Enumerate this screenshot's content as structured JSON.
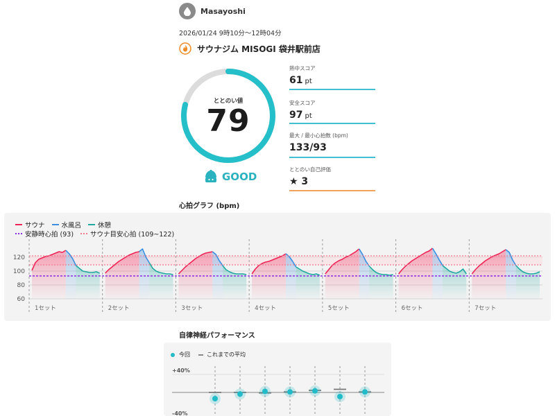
{
  "user": {
    "name": "Masayoshi",
    "avatar_icon": "water-drop-icon"
  },
  "session": {
    "datetime": "2026/01/24 9時10分〜12時04分"
  },
  "facility": {
    "name": "サウナジム MISOGI 袋井駅前店",
    "icon": "flame-icon"
  },
  "totonoi": {
    "label": "ととのい値",
    "value": "79",
    "max": 100,
    "progress": 0.79,
    "rating": "GOOD",
    "rating_icon": "sauna-mascot-icon"
  },
  "stats": [
    {
      "label": "熱中スコア",
      "value": "61",
      "unit": "pt"
    },
    {
      "label": "安全スコア",
      "value": "97",
      "unit": "pt"
    },
    {
      "label": "最大 / 最小心拍数 (bpm)",
      "value": "133/93",
      "unit": ""
    },
    {
      "label": "ととのい自己評価",
      "value": "★ 3",
      "unit": ""
    }
  ],
  "heart_rate": {
    "title": "心拍グラフ (bpm)",
    "legend": {
      "sauna": "サウナ",
      "cold_bath": "水風呂",
      "rest": "休憩",
      "resting_hr": "安静時心拍 (93)",
      "sauna_target": "サウナ目安心拍 (109~122)"
    },
    "colors": {
      "sauna": "#ee2255",
      "cold_bath": "#3a8fe0",
      "rest": "#1fa8a0",
      "resting_hr": "#8a2be2",
      "target": "#ef7a8f"
    }
  },
  "chart_data": [
    {
      "type": "line",
      "title": "心拍グラフ (bpm)",
      "ylim": [
        60,
        140
      ],
      "yticks": [
        60,
        80,
        100,
        120
      ],
      "resting_hr": 93,
      "target_range": [
        109,
        122
      ],
      "sets": [
        {
          "label": "1セット",
          "sauna": [
            [
              0,
              101
            ],
            [
              1,
              112
            ],
            [
              2,
              117
            ],
            [
              3,
              119
            ],
            [
              4,
              121
            ],
            [
              5,
              122
            ],
            [
              6,
              124
            ],
            [
              7,
              126
            ],
            [
              8,
              128
            ],
            [
              9,
              127
            ],
            [
              10,
              130
            ]
          ],
          "cold_bath": [
            [
              10,
              130
            ],
            [
              11,
              125
            ],
            [
              12,
              118
            ],
            [
              13,
              108
            ]
          ],
          "rest": [
            [
              13,
              108
            ],
            [
              14,
              104
            ],
            [
              15,
              100
            ],
            [
              16,
              99
            ],
            [
              17,
              98
            ],
            [
              18,
              98
            ],
            [
              19,
              99
            ],
            [
              20,
              97
            ]
          ]
        },
        {
          "label": "2セット",
          "sauna": [
            [
              0,
              97
            ],
            [
              1,
              102
            ],
            [
              2,
              106
            ],
            [
              3,
              110
            ],
            [
              4,
              114
            ],
            [
              5,
              117
            ],
            [
              6,
              120
            ],
            [
              7,
              123
            ],
            [
              8,
              125
            ],
            [
              9,
              127
            ],
            [
              10,
              128
            ]
          ],
          "cold_bath": [
            [
              10,
              128
            ],
            [
              11,
              132
            ],
            [
              12,
              120
            ],
            [
              13,
              112
            ]
          ],
          "rest": [
            [
              13,
              112
            ],
            [
              14,
              104
            ],
            [
              15,
              100
            ],
            [
              16,
              98
            ],
            [
              17,
              97
            ],
            [
              18,
              96
            ],
            [
              19,
              96
            ],
            [
              20,
              95
            ]
          ]
        },
        {
          "label": "3セット",
          "sauna": [
            [
              0,
              96
            ],
            [
              1,
              101
            ],
            [
              2,
              106
            ],
            [
              3,
              110
            ],
            [
              4,
              114
            ],
            [
              5,
              118
            ],
            [
              6,
              121
            ],
            [
              7,
              124
            ],
            [
              8,
              126
            ],
            [
              9,
              127
            ],
            [
              10,
              128
            ]
          ],
          "cold_bath": [
            [
              10,
              128
            ],
            [
              11,
              124
            ],
            [
              12,
              115
            ],
            [
              13,
              108
            ]
          ],
          "rest": [
            [
              13,
              108
            ],
            [
              14,
              102
            ],
            [
              15,
              99
            ],
            [
              16,
              97
            ],
            [
              17,
              96
            ],
            [
              18,
              96
            ],
            [
              19,
              96
            ],
            [
              20,
              95
            ]
          ]
        },
        {
          "label": "4セット",
          "sauna": [
            [
              0,
              96
            ],
            [
              1,
              103
            ],
            [
              2,
              108
            ],
            [
              3,
              111
            ],
            [
              4,
              113
            ],
            [
              5,
              114
            ],
            [
              6,
              116
            ],
            [
              7,
              118
            ],
            [
              8,
              120
            ],
            [
              9,
              122
            ],
            [
              10,
              125
            ]
          ],
          "cold_bath": [
            [
              10,
              125
            ],
            [
              11,
              121
            ],
            [
              12,
              114
            ],
            [
              13,
              106
            ]
          ],
          "rest": [
            [
              13,
              106
            ],
            [
              14,
              103
            ],
            [
              15,
              100
            ],
            [
              16,
              98
            ],
            [
              17,
              96
            ],
            [
              18,
              95
            ],
            [
              19,
              96
            ],
            [
              20,
              94
            ]
          ]
        },
        {
          "label": "5セット",
          "sauna": [
            [
              0,
              96
            ],
            [
              1,
              102
            ],
            [
              2,
              108
            ],
            [
              3,
              112
            ],
            [
              4,
              115
            ],
            [
              5,
              117
            ],
            [
              6,
              120
            ],
            [
              7,
              122
            ],
            [
              8,
              125
            ],
            [
              9,
              128
            ],
            [
              10,
              132
            ]
          ],
          "cold_bath": [
            [
              10,
              132
            ],
            [
              11,
              124
            ],
            [
              12,
              114
            ],
            [
              13,
              107
            ]
          ],
          "rest": [
            [
              13,
              107
            ],
            [
              14,
              102
            ],
            [
              15,
              98
            ],
            [
              16,
              96
            ],
            [
              17,
              95
            ],
            [
              18,
              95
            ],
            [
              19,
              94
            ],
            [
              20,
              95
            ]
          ]
        },
        {
          "label": "6セット",
          "sauna": [
            [
              0,
              96
            ],
            [
              1,
              102
            ],
            [
              2,
              107
            ],
            [
              3,
              111
            ],
            [
              4,
              115
            ],
            [
              5,
              118
            ],
            [
              6,
              121
            ],
            [
              7,
              124
            ],
            [
              8,
              127
            ],
            [
              9,
              129
            ],
            [
              10,
              133
            ]
          ],
          "cold_bath": [
            [
              10,
              133
            ],
            [
              11,
              125
            ],
            [
              12,
              116
            ],
            [
              13,
              108
            ]
          ],
          "rest": [
            [
              13,
              108
            ],
            [
              14,
              104
            ],
            [
              15,
              100
            ],
            [
              16,
              98
            ],
            [
              17,
              97
            ],
            [
              18,
              99
            ],
            [
              19,
              103
            ],
            [
              20,
              96
            ]
          ]
        },
        {
          "label": "7セット",
          "sauna": [
            [
              0,
              96
            ],
            [
              1,
              102
            ],
            [
              2,
              107
            ],
            [
              3,
              111
            ],
            [
              4,
              115
            ],
            [
              5,
              118
            ],
            [
              6,
              121
            ],
            [
              7,
              123
            ],
            [
              8,
              125
            ],
            [
              9,
              128
            ],
            [
              10,
              131
            ]
          ],
          "cold_bath": [
            [
              10,
              131
            ],
            [
              11,
              127
            ],
            [
              12,
              116
            ],
            [
              13,
              108
            ]
          ],
          "rest": [
            [
              13,
              108
            ],
            [
              14,
              103
            ],
            [
              15,
              99
            ],
            [
              16,
              97
            ],
            [
              17,
              96
            ],
            [
              18,
              96
            ],
            [
              19,
              97
            ],
            [
              20,
              99
            ]
          ]
        }
      ]
    },
    {
      "type": "scatter",
      "title": "自律神経パフォーマンス",
      "legend": {
        "current": "今回",
        "average": "これまでの平均"
      },
      "yticks": [
        "+40%",
        "-40%"
      ],
      "ylim": [
        -40,
        40
      ],
      "points": [
        {
          "current": -12,
          "average": 0
        },
        {
          "current": -3,
          "average": 0
        },
        {
          "current": 2,
          "average": -1
        },
        {
          "current": 1,
          "average": 1
        },
        {
          "current": 3,
          "average": 4
        },
        {
          "current": -8,
          "average": 6
        },
        {
          "current": 1,
          "average": 1
        }
      ]
    }
  ],
  "perf": {
    "title": "自律神経パフォーマンス",
    "legend_current": "今回",
    "legend_average": "これまでの平均",
    "label_top": "+40%",
    "label_bottom": "-40%"
  }
}
